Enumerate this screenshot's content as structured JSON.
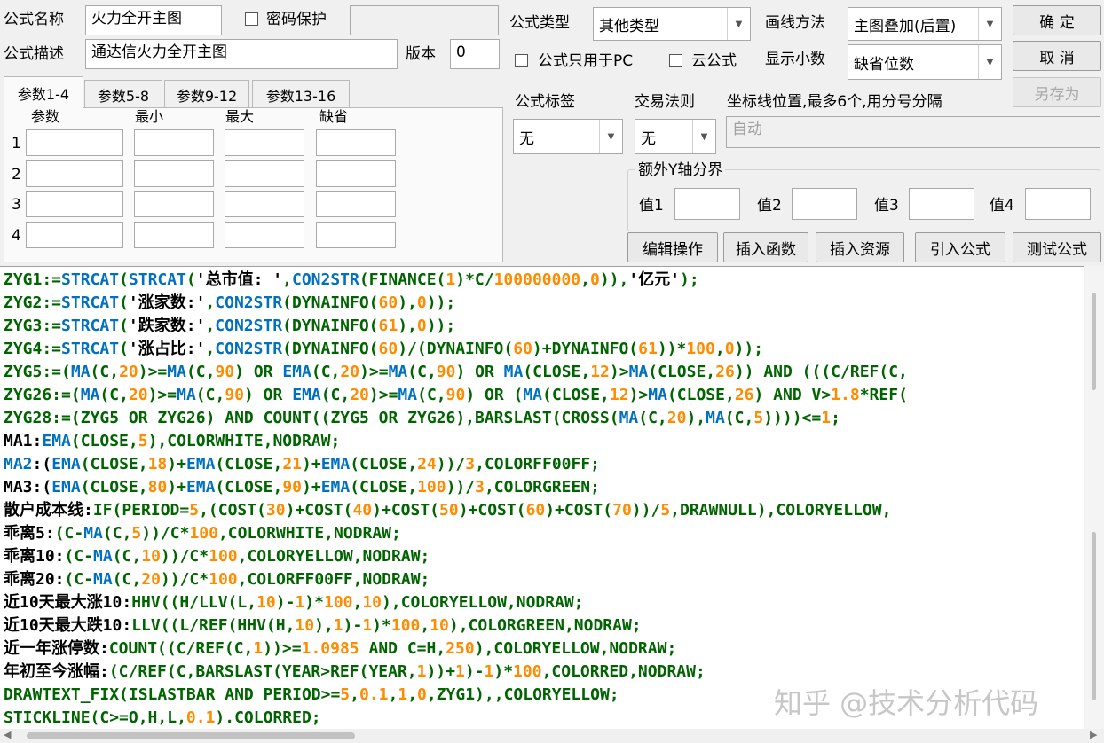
{
  "colors": {
    "function": "#0070c0",
    "keyword": "#006400",
    "number": "#ff8c00",
    "text": "#000000",
    "watermark": "#c7c7c7"
  },
  "header": {
    "name_label": "公式名称",
    "name_value": "火力全开主图",
    "password_label": "密码保护",
    "password_checked": false,
    "password_value": "",
    "desc_label": "公式描述",
    "desc_value": "通达信火力全开主图",
    "version_label": "版本",
    "version_value": "0",
    "type_label": "公式类型",
    "type_value": "其他类型",
    "draw_label": "画线方法",
    "draw_value": "主图叠加(后置)",
    "pc_only_label": "公式只用于PC",
    "cloud_label": "云公式",
    "decimals_label": "显示小数",
    "decimals_value": "缺省位数",
    "ok_button": "确 定",
    "cancel_button": "取 消",
    "save_as_button": "另存为",
    "tag_label": "公式标签",
    "tag_value": "无",
    "trade_label": "交易法则",
    "trade_value": "无",
    "coord_label": "坐标线位置,最多6个,用分号分隔",
    "coord_value": "自动",
    "yaxis_group_label": "额外Y轴分界",
    "yaxis_values": [
      "值1",
      "值2",
      "值3",
      "值4"
    ]
  },
  "tabs": [
    "参数1-4",
    "参数5-8",
    "参数9-12",
    "参数13-16"
  ],
  "params": {
    "columns": [
      "参数",
      "最小",
      "最大",
      "缺省"
    ],
    "rows": [
      "1",
      "2",
      "3",
      "4"
    ]
  },
  "actions": {
    "edit": "编辑操作",
    "insert_function": "插入函数",
    "insert_resource": "插入资源",
    "import_formula": "引入公式",
    "test_formula": "测试公式"
  },
  "code_lines": [
    [
      [
        "k",
        "ZYG1:="
      ],
      [
        "f",
        "STRCAT"
      ],
      [
        "k",
        "("
      ],
      [
        "f",
        "STRCAT"
      ],
      [
        "k",
        "("
      ],
      [
        "t",
        "'总市值: '"
      ],
      [
        "k",
        ","
      ],
      [
        "f",
        "CON2STR"
      ],
      [
        "k",
        "(FINANCE("
      ],
      [
        "n",
        "1"
      ],
      [
        "k",
        ")*C/"
      ],
      [
        "n",
        "100000000"
      ],
      [
        "k",
        ","
      ],
      [
        "n",
        "0"
      ],
      [
        "k",
        ")),"
      ],
      [
        "t",
        "'亿元'"
      ],
      [
        "k",
        ");"
      ]
    ],
    [
      [
        "k",
        "ZYG2:="
      ],
      [
        "f",
        "STRCAT"
      ],
      [
        "k",
        "("
      ],
      [
        "t",
        "'涨家数:'"
      ],
      [
        "k",
        ","
      ],
      [
        "f",
        "CON2STR"
      ],
      [
        "k",
        "(DYNAINFO("
      ],
      [
        "n",
        "60"
      ],
      [
        "k",
        "),"
      ],
      [
        "n",
        "0"
      ],
      [
        "k",
        "));"
      ]
    ],
    [
      [
        "k",
        "ZYG3:="
      ],
      [
        "f",
        "STRCAT"
      ],
      [
        "k",
        "("
      ],
      [
        "t",
        "'跌家数:'"
      ],
      [
        "k",
        ","
      ],
      [
        "f",
        "CON2STR"
      ],
      [
        "k",
        "(DYNAINFO("
      ],
      [
        "n",
        "61"
      ],
      [
        "k",
        "),"
      ],
      [
        "n",
        "0"
      ],
      [
        "k",
        "));"
      ]
    ],
    [
      [
        "k",
        "ZYG4:="
      ],
      [
        "f",
        "STRCAT"
      ],
      [
        "k",
        "("
      ],
      [
        "t",
        "'涨占比:'"
      ],
      [
        "k",
        ","
      ],
      [
        "f",
        "CON2STR"
      ],
      [
        "k",
        "(DYNAINFO("
      ],
      [
        "n",
        "60"
      ],
      [
        "k",
        ")/(DYNAINFO("
      ],
      [
        "n",
        "60"
      ],
      [
        "k",
        ")+DYNAINFO("
      ],
      [
        "n",
        "61"
      ],
      [
        "k",
        "))*"
      ],
      [
        "n",
        "100"
      ],
      [
        "k",
        ","
      ],
      [
        "n",
        "0"
      ],
      [
        "k",
        "));"
      ]
    ],
    [
      [
        "k",
        "ZYG5:=("
      ],
      [
        "f",
        "MA"
      ],
      [
        "k",
        "(C,"
      ],
      [
        "n",
        "20"
      ],
      [
        "k",
        ")>="
      ],
      [
        "f",
        "MA"
      ],
      [
        "k",
        "(C,"
      ],
      [
        "n",
        "90"
      ],
      [
        "k",
        ") OR "
      ],
      [
        "f",
        "EMA"
      ],
      [
        "k",
        "(C,"
      ],
      [
        "n",
        "20"
      ],
      [
        "k",
        ")>="
      ],
      [
        "f",
        "MA"
      ],
      [
        "k",
        "(C,"
      ],
      [
        "n",
        "90"
      ],
      [
        "k",
        ") OR "
      ],
      [
        "f",
        "MA"
      ],
      [
        "k",
        "(CLOSE,"
      ],
      [
        "n",
        "12"
      ],
      [
        "k",
        ")>"
      ],
      [
        "f",
        "MA"
      ],
      [
        "k",
        "(CLOSE,"
      ],
      [
        "n",
        "26"
      ],
      [
        "k",
        ")) AND (((C/REF(C,"
      ]
    ],
    [
      [
        "k",
        "ZYG26:=("
      ],
      [
        "f",
        "MA"
      ],
      [
        "k",
        "(C,"
      ],
      [
        "n",
        "20"
      ],
      [
        "k",
        ")>="
      ],
      [
        "f",
        "MA"
      ],
      [
        "k",
        "(C,"
      ],
      [
        "n",
        "90"
      ],
      [
        "k",
        ") OR "
      ],
      [
        "f",
        "EMA"
      ],
      [
        "k",
        "(C,"
      ],
      [
        "n",
        "20"
      ],
      [
        "k",
        ")>="
      ],
      [
        "f",
        "MA"
      ],
      [
        "k",
        "(C,"
      ],
      [
        "n",
        "90"
      ],
      [
        "k",
        ") OR ("
      ],
      [
        "f",
        "MA"
      ],
      [
        "k",
        "(CLOSE,"
      ],
      [
        "n",
        "12"
      ],
      [
        "k",
        ")>"
      ],
      [
        "f",
        "MA"
      ],
      [
        "k",
        "(CLOSE,"
      ],
      [
        "n",
        "26"
      ],
      [
        "k",
        ") AND V>"
      ],
      [
        "n",
        "1.8"
      ],
      [
        "k",
        "*REF("
      ]
    ],
    [
      [
        "k",
        "ZYG28:=(ZYG5 OR ZYG26) AND COUNT((ZYG5 OR ZYG26),BARSLAST(CROSS("
      ],
      [
        "f",
        "MA"
      ],
      [
        "k",
        "(C,"
      ],
      [
        "n",
        "20"
      ],
      [
        "k",
        "),"
      ],
      [
        "f",
        "MA"
      ],
      [
        "k",
        "(C,"
      ],
      [
        "n",
        "5"
      ],
      [
        "k",
        "))))<="
      ],
      [
        "n",
        "1"
      ],
      [
        "k",
        ";"
      ]
    ],
    [
      [
        "t",
        "MA1:"
      ],
      [
        "f",
        "EMA"
      ],
      [
        "k",
        "(CLOSE,"
      ],
      [
        "n",
        "5"
      ],
      [
        "k",
        "),COLORWHITE,NODRAW;"
      ]
    ],
    [
      [
        "f",
        "MA2"
      ],
      [
        "t",
        ":("
      ],
      [
        "f",
        "EMA"
      ],
      [
        "k",
        "(CLOSE,"
      ],
      [
        "n",
        "18"
      ],
      [
        "k",
        ")+"
      ],
      [
        "f",
        "EMA"
      ],
      [
        "k",
        "(CLOSE,"
      ],
      [
        "n",
        "21"
      ],
      [
        "k",
        ")+"
      ],
      [
        "f",
        "EMA"
      ],
      [
        "k",
        "(CLOSE,"
      ],
      [
        "n",
        "24"
      ],
      [
        "k",
        "))/"
      ],
      [
        "n",
        "3"
      ],
      [
        "k",
        ",COLORFF00FF;"
      ]
    ],
    [
      [
        "t",
        "MA3:("
      ],
      [
        "f",
        "EMA"
      ],
      [
        "k",
        "(CLOSE,"
      ],
      [
        "n",
        "80"
      ],
      [
        "k",
        ")+"
      ],
      [
        "f",
        "EMA"
      ],
      [
        "k",
        "(CLOSE,"
      ],
      [
        "n",
        "90"
      ],
      [
        "k",
        ")+"
      ],
      [
        "f",
        "EMA"
      ],
      [
        "k",
        "(CLOSE,"
      ],
      [
        "n",
        "100"
      ],
      [
        "k",
        "))/"
      ],
      [
        "n",
        "3"
      ],
      [
        "k",
        ",COLORGREEN;"
      ]
    ],
    [
      [
        "t",
        "散户成本线:"
      ],
      [
        "k",
        "IF(PERIOD="
      ],
      [
        "n",
        "5"
      ],
      [
        "k",
        ",(COST("
      ],
      [
        "n",
        "30"
      ],
      [
        "k",
        ")+COST("
      ],
      [
        "n",
        "40"
      ],
      [
        "k",
        ")+COST("
      ],
      [
        "n",
        "50"
      ],
      [
        "k",
        ")+COST("
      ],
      [
        "n",
        "60"
      ],
      [
        "k",
        ")+COST("
      ],
      [
        "n",
        "70"
      ],
      [
        "k",
        "))/"
      ],
      [
        "n",
        "5"
      ],
      [
        "k",
        ",DRAWNULL),COLORYELLOW,"
      ]
    ],
    [
      [
        "t",
        "乖离5:"
      ],
      [
        "k",
        "(C-"
      ],
      [
        "f",
        "MA"
      ],
      [
        "k",
        "(C,"
      ],
      [
        "n",
        "5"
      ],
      [
        "k",
        "))/C*"
      ],
      [
        "n",
        "100"
      ],
      [
        "k",
        ",COLORWHITE,NODRAW;"
      ]
    ],
    [
      [
        "t",
        "乖离10:"
      ],
      [
        "k",
        "(C-"
      ],
      [
        "f",
        "MA"
      ],
      [
        "k",
        "(C,"
      ],
      [
        "n",
        "10"
      ],
      [
        "k",
        "))/C*"
      ],
      [
        "n",
        "100"
      ],
      [
        "k",
        ",COLORYELLOW,NODRAW;"
      ]
    ],
    [
      [
        "t",
        "乖离20:"
      ],
      [
        "k",
        "(C-"
      ],
      [
        "f",
        "MA"
      ],
      [
        "k",
        "(C,"
      ],
      [
        "n",
        "20"
      ],
      [
        "k",
        "))/C*"
      ],
      [
        "n",
        "100"
      ],
      [
        "k",
        ",COLORFF00FF,NODRAW;"
      ]
    ],
    [
      [
        "t",
        "近10天最大涨10:"
      ],
      [
        "k",
        "HHV((H/LLV(L,"
      ],
      [
        "n",
        "10"
      ],
      [
        "k",
        ")-"
      ],
      [
        "n",
        "1"
      ],
      [
        "k",
        ")*"
      ],
      [
        "n",
        "100"
      ],
      [
        "k",
        ","
      ],
      [
        "n",
        "10"
      ],
      [
        "k",
        "),COLORYELLOW,NODRAW;"
      ]
    ],
    [
      [
        "t",
        "近10天最大跌10:"
      ],
      [
        "k",
        "LLV((L/REF(HHV(H,"
      ],
      [
        "n",
        "10"
      ],
      [
        "k",
        "),"
      ],
      [
        "n",
        "1"
      ],
      [
        "k",
        ")-"
      ],
      [
        "n",
        "1"
      ],
      [
        "k",
        ")*"
      ],
      [
        "n",
        "100"
      ],
      [
        "k",
        ","
      ],
      [
        "n",
        "10"
      ],
      [
        "k",
        "),COLORGREEN,NODRAW;"
      ]
    ],
    [
      [
        "t",
        "近一年涨停数:"
      ],
      [
        "k",
        "COUNT((C/REF(C,"
      ],
      [
        "n",
        "1"
      ],
      [
        "k",
        "))>="
      ],
      [
        "n",
        "1.0985"
      ],
      [
        "k",
        " AND C=H,"
      ],
      [
        "n",
        "250"
      ],
      [
        "k",
        "),COLORYELLOW,NODRAW;"
      ]
    ],
    [
      [
        "t",
        "年初至今涨幅:"
      ],
      [
        "k",
        "(C/REF(C,BARSLAST(YEAR>REF(YEAR,"
      ],
      [
        "n",
        "1"
      ],
      [
        "k",
        "))+"
      ],
      [
        "n",
        "1"
      ],
      [
        "k",
        ")-"
      ],
      [
        "n",
        "1"
      ],
      [
        "k",
        ")*"
      ],
      [
        "n",
        "100"
      ],
      [
        "k",
        ",COLORRED,NODRAW;"
      ]
    ],
    [
      [
        "k",
        "DRAWTEXT_FIX(ISLASTBAR AND PERIOD>="
      ],
      [
        "n",
        "5"
      ],
      [
        "k",
        ","
      ],
      [
        "n",
        "0.1"
      ],
      [
        "k",
        ","
      ],
      [
        "n",
        "1"
      ],
      [
        "k",
        ","
      ],
      [
        "n",
        "0"
      ],
      [
        "k",
        ",ZYG1),,COLORYELLOW;"
      ]
    ],
    [
      [
        "k",
        "STICKLINE(C>=O,H,L,"
      ],
      [
        "n",
        "0.1"
      ],
      [
        "k",
        ").COLORRED;"
      ]
    ]
  ],
  "watermark": "知乎 @技术分析代码"
}
